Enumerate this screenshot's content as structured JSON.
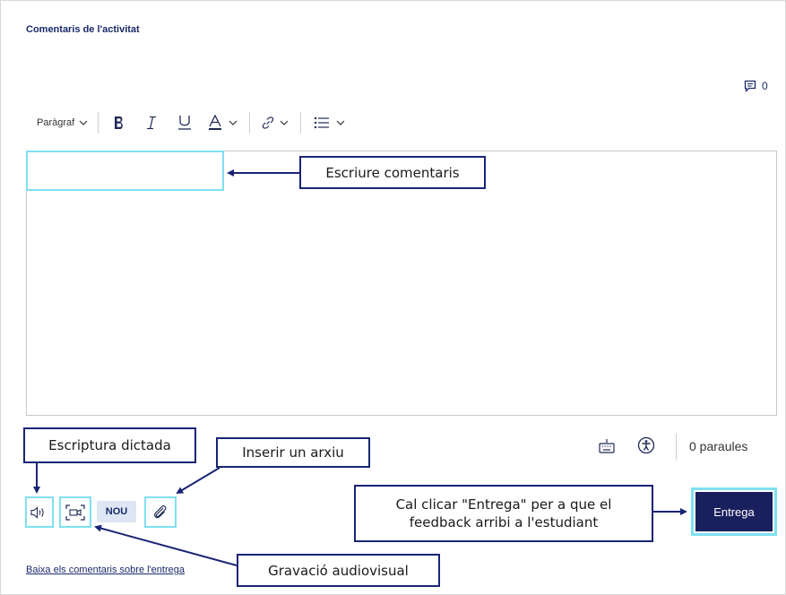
{
  "section": {
    "title": "Comentaris de l'activitat"
  },
  "comments": {
    "count": "0"
  },
  "toolbar": {
    "paragraph_label": "Paràgraf"
  },
  "editor": {
    "value": ""
  },
  "footer": {
    "word_count": "0 paraules",
    "new_badge": "NOU",
    "submit_label": "Entrega",
    "download_link": "Baixa els comentaris sobre l'entrega"
  },
  "callouts": {
    "write_comments": "Escriure comentaris",
    "dictation": "Escriptura dictada",
    "insert_file": "Inserir un arxiu",
    "audiovisual": "Gravació audiovisual",
    "submit_note": "Cal clicar \"Entrega\" per a que el feedback arribi a l'estudiant"
  },
  "icons": [
    "comment-icon",
    "bold-icon",
    "italic-icon",
    "underline-icon",
    "text-color-icon",
    "link-icon",
    "list-icon",
    "keyboard-icon",
    "accessibility-icon",
    "microphone-icon",
    "video-record-icon",
    "paperclip-icon"
  ],
  "colors": {
    "brand": "#1a1f5e",
    "highlight": "#7fe0f0",
    "callout_border": "#1a2475"
  }
}
